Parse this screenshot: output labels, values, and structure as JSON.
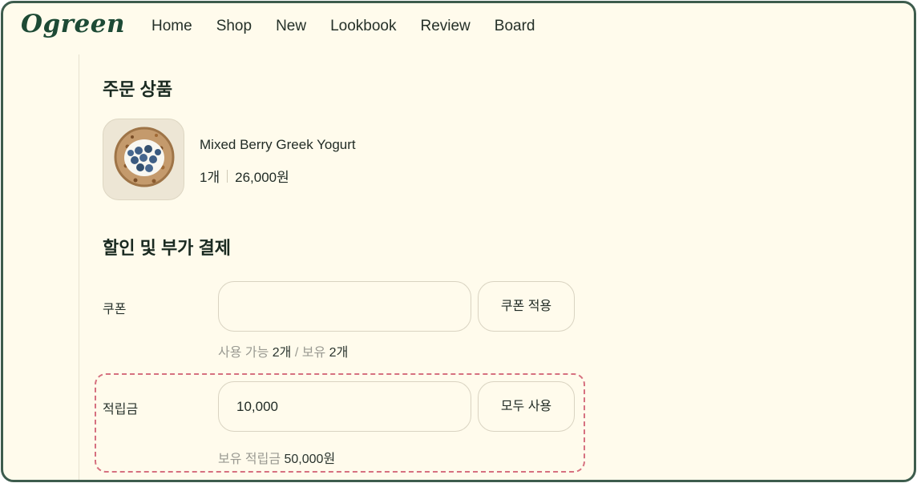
{
  "header": {
    "logo": "Ogreen",
    "nav": [
      "Home",
      "Shop",
      "New",
      "Lookbook",
      "Review",
      "Board"
    ]
  },
  "order": {
    "title": "주문 상품",
    "product": {
      "name": "Mixed Berry Greek Yogurt",
      "quantity": "1개",
      "price": "26,000원",
      "image": "yogurt-bowl-image"
    }
  },
  "discount": {
    "title": "할인 및 부가 결제",
    "coupon": {
      "label": "쿠폰",
      "value": "",
      "apply_button": "쿠폰 적용",
      "hint_available_label": "사용 가능",
      "hint_available_count": "2개",
      "hint_separator": "/",
      "hint_owned_label": "보유",
      "hint_owned_count": "2개"
    },
    "points": {
      "label": "적립금",
      "value": "10,000",
      "use_all_button": "모두 사용",
      "hint_label": "보유 적립금",
      "hint_amount": "50,000원"
    }
  },
  "colors": {
    "background": "#fffbec",
    "frame_border": "#3d5c4d",
    "logo": "#1d4a35",
    "highlight_dashed": "#d6707f"
  }
}
